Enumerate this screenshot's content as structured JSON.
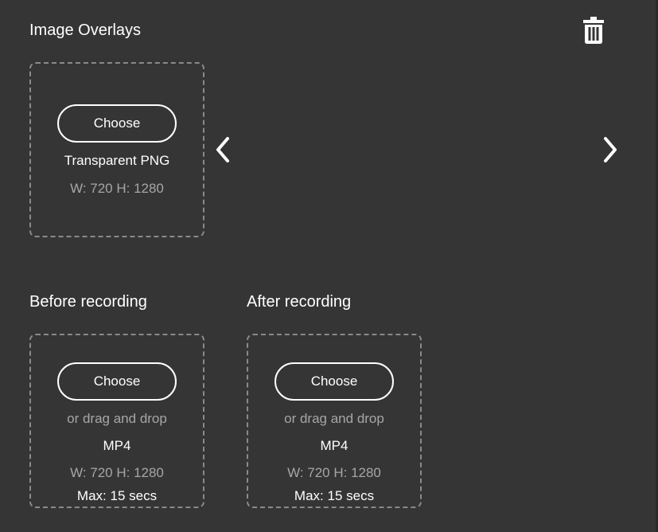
{
  "image_overlays": {
    "title": "Image Overlays",
    "delete_icon": "trash-icon",
    "choose_label": "Choose",
    "format": "Transparent PNG",
    "dimensions": "W: 720 H: 1280",
    "prev_icon": "chevron-left-icon",
    "next_icon": "chevron-right-icon"
  },
  "before_recording": {
    "title": "Before recording",
    "choose_label": "Choose",
    "drag_hint": "or drag and drop",
    "format": "MP4",
    "dimensions": "W: 720 H: 1280",
    "max_length": "Max: 15 secs"
  },
  "after_recording": {
    "title": "After recording",
    "choose_label": "Choose",
    "drag_hint": "or drag and drop",
    "format": "MP4",
    "dimensions": "W: 720 H: 1280",
    "max_length": "Max: 15 secs"
  },
  "colors": {
    "background": "#353535",
    "text": "#ffffff",
    "muted_text": "#a6a6a6",
    "dashed_border": "#8a8a8a"
  }
}
